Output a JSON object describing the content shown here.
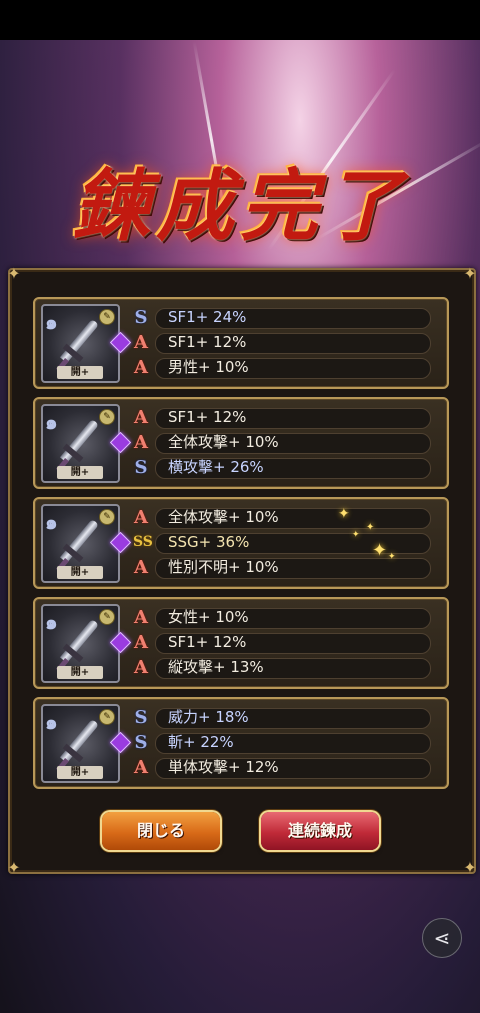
{
  "banner": {
    "title": "鍊成完了"
  },
  "items": [
    {
      "weapon_label": "開+",
      "effects": [
        {
          "icon": "s-rank-icon",
          "text": "SF1+ 24%",
          "style": "blue"
        },
        {
          "icon": "a-rank-icon",
          "text": "SF1+ 12%",
          "style": "normal"
        },
        {
          "icon": "a-rank-icon",
          "text": "男性+ 10%",
          "style": "normal"
        }
      ]
    },
    {
      "weapon_label": "開+",
      "effects": [
        {
          "icon": "a-rank-icon",
          "text": "SF1+ 12%",
          "style": "normal"
        },
        {
          "icon": "a-rank-icon",
          "text": "全体攻撃+ 10%",
          "style": "normal"
        },
        {
          "icon": "s-rank-icon",
          "text": "横攻撃+ 26%",
          "style": "blue"
        }
      ]
    },
    {
      "weapon_label": "開+",
      "effects": [
        {
          "icon": "a-rank-icon",
          "text": "全体攻撃+ 10%",
          "style": "normal"
        },
        {
          "icon": "ssg-rank-icon",
          "text": "SSG+ 36%",
          "style": "gold"
        },
        {
          "icon": "a-rank-icon",
          "text": "性別不明+ 10%",
          "style": "normal"
        }
      ]
    },
    {
      "weapon_label": "開+",
      "effects": [
        {
          "icon": "a-rank-icon",
          "text": "女性+ 10%",
          "style": "normal"
        },
        {
          "icon": "a-rank-icon",
          "text": "SF1+ 12%",
          "style": "normal"
        },
        {
          "icon": "a-rank-icon",
          "text": "縦攻撃+ 13%",
          "style": "normal"
        }
      ]
    },
    {
      "weapon_label": "開+",
      "effects": [
        {
          "icon": "s-rank-icon",
          "text": "威力+ 18%",
          "style": "blue"
        },
        {
          "icon": "s-rank-icon",
          "text": "斬+ 22%",
          "style": "blue"
        },
        {
          "icon": "a-rank-icon",
          "text": "単体攻撃+ 12%",
          "style": "normal"
        }
      ]
    }
  ],
  "buttons": {
    "close_label": "閉じる",
    "continue_label": "連続鍊成"
  },
  "colors": {
    "rank_a": "#f08070",
    "rank_s": "#9fb0e8",
    "rank_ssg": "#e8c040",
    "frame_gold": "#b89858"
  }
}
